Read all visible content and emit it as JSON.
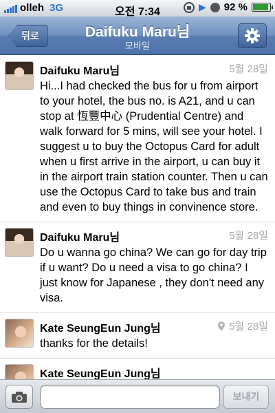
{
  "statusbar": {
    "carrier": "olleh",
    "network": "3G",
    "time": "오전 7:34",
    "battery": "92 %",
    "battery_level": 0.92,
    "signal_bars": 5
  },
  "navbar": {
    "back_label": "뒤로",
    "title": "Daifuku Maru님",
    "subtitle": "모바일",
    "settings_icon": "gear-icon"
  },
  "messages": [
    {
      "sender": "Daifuku Maru님",
      "date": "5월 28일",
      "location_icon": false,
      "text": "Hi...I had checked the bus for u from airport to your hotel, the bus no. is A21, and u can stop at 恆豐中心 (Prudential Centre) and walk forward for 5 mins, will see your hotel. I suggest u to buy the Octopus Card for adult when u first arrive in the airport, u can buy it in the airport train station counter. Then u can use the Octopus Card to take bus and train and even to buy things in convinence store."
    },
    {
      "sender": "Daifuku Maru님",
      "date": "5월 28일",
      "location_icon": false,
      "text": "Do u wanna go china? We can go for day trip if u want? Do u need a visa to go china? I just know for Japanese , they don't need any visa."
    },
    {
      "sender": "Kate SeungEun Jung님",
      "date": "5월 28일",
      "location_icon": true,
      "text": "thanks for the details!"
    },
    {
      "sender": "Kate SeungEun Jung님",
      "date": "",
      "location_icon": false,
      "text": ""
    }
  ],
  "compose": {
    "input_value": "",
    "input_placeholder": "",
    "send_label": "보내기",
    "camera_icon": "camera-icon"
  },
  "colors": {
    "nav_blue": "#4d72a9",
    "date_gray": "#a8a8a8",
    "network_blue": "#2c73d2",
    "battery_green": "#2e9d2e"
  }
}
